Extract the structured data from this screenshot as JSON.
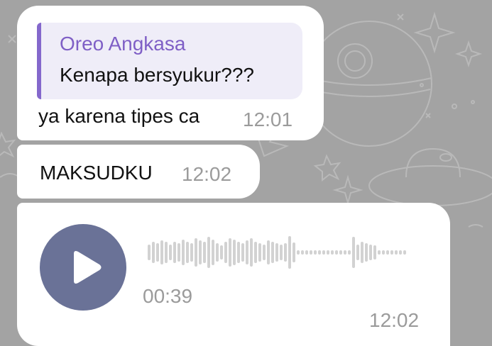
{
  "chat": {
    "background_color": "#a3a3a3",
    "messages": [
      {
        "type": "reply",
        "reply_to": {
          "name": "Oreo Angkasa",
          "text": "Kenapa bersyukur???",
          "accent_color": "#8468cc"
        },
        "text": "ya karena tipes ca",
        "time": "12:01"
      },
      {
        "type": "text",
        "text": "MAKSUDKU",
        "time": "12:02"
      },
      {
        "type": "voice",
        "duration": "00:39",
        "time": "12:02",
        "play_icon": "play-icon",
        "button_color": "#6a7297"
      }
    ]
  }
}
